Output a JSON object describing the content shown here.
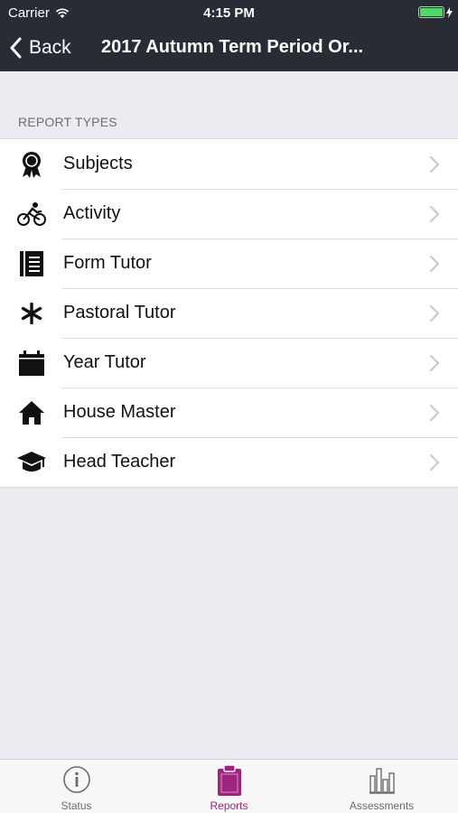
{
  "status_bar": {
    "carrier": "Carrier",
    "time": "4:15 PM"
  },
  "nav": {
    "back_label": "Back",
    "title": "2017 Autumn Term Period Or..."
  },
  "section": {
    "header": "REPORT TYPES"
  },
  "report_types": [
    {
      "label": "Subjects",
      "icon": "award-ribbon-icon"
    },
    {
      "label": "Activity",
      "icon": "cyclist-icon"
    },
    {
      "label": "Form Tutor",
      "icon": "document-icon"
    },
    {
      "label": "Pastoral Tutor",
      "icon": "asterisk-icon"
    },
    {
      "label": "Year Tutor",
      "icon": "calendar-icon"
    },
    {
      "label": "House Master",
      "icon": "house-icon"
    },
    {
      "label": "Head Teacher",
      "icon": "graduation-cap-icon"
    }
  ],
  "tabs": [
    {
      "label": "Status",
      "icon": "info-icon",
      "active": false
    },
    {
      "label": "Reports",
      "icon": "clipboard-icon",
      "active": true
    },
    {
      "label": "Assessments",
      "icon": "bar-chart-icon",
      "active": false
    }
  ],
  "colors": {
    "nav_bg": "#2a2c35",
    "accent": "#a0247f",
    "background": "#ebebf1"
  }
}
